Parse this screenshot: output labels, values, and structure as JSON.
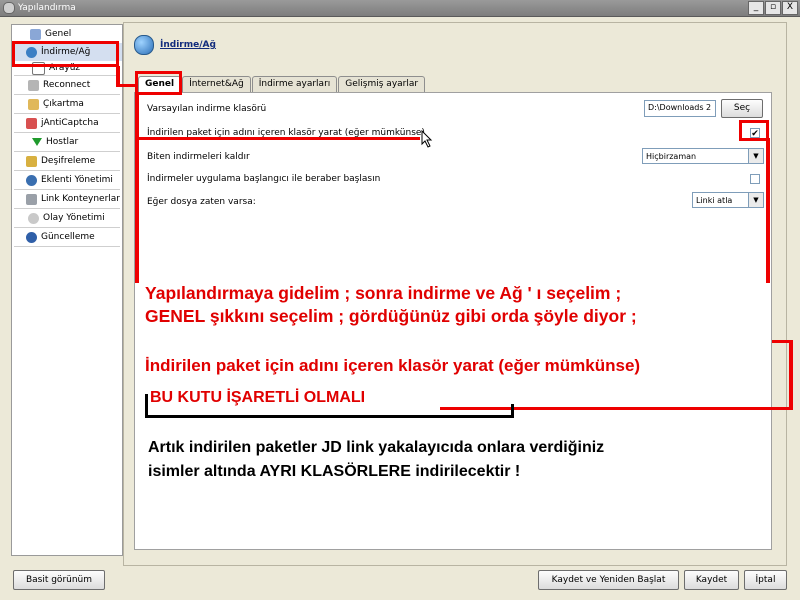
{
  "window": {
    "title": "Yapılandırma",
    "controls": [
      "_",
      "▫",
      "X"
    ]
  },
  "sidebar": {
    "items": [
      {
        "label": "Genel",
        "icon": "house-icon"
      },
      {
        "label": "İndirme/Ağ",
        "icon": "globe-icon"
      },
      {
        "label": "Arayüz",
        "icon": "window-icon"
      },
      {
        "label": "Reconnect",
        "icon": "reconnect-icon"
      },
      {
        "label": "Çıkartma",
        "icon": "extract-icon"
      },
      {
        "label": "jAntiCaptcha",
        "icon": "captcha-icon"
      },
      {
        "label": "Hostlar",
        "icon": "arrow-down-icon"
      },
      {
        "label": "Deşifreleme",
        "icon": "lock-icon"
      },
      {
        "label": "Eklenti Yönetimi",
        "icon": "plugin-icon"
      },
      {
        "label": "Link Konteynerlar",
        "icon": "container-icon"
      },
      {
        "label": "Olay Yönetimi",
        "icon": "event-icon"
      },
      {
        "label": "Güncelleme",
        "icon": "update-icon"
      }
    ]
  },
  "main": {
    "title": "İndirme/Ağ",
    "tabs": [
      "Genel",
      "İnternet&Ağ",
      "İndirme ayarları",
      "Gelişmiş ayarlar"
    ],
    "settings": {
      "download_folder_label": "Varsayılan indirme klasörü",
      "download_folder_value": "D:\\Downloads 2",
      "browse_button": "Seç",
      "create_subfolder_label": "İndirilen paket için adını içeren klasör yarat (eğer mümkünse)",
      "create_subfolder_checked": "✔",
      "remove_finished_label": "Biten indirmeleri kaldır",
      "remove_finished_value": "Hiçbirzaman",
      "start_with_app_label": "İndirmeler uygulama başlangıcı ile beraber başlasın",
      "file_exists_label": "Eğer dosya zaten varsa:",
      "file_exists_value": "Linki atla"
    }
  },
  "annotations": {
    "line1": "Yapılandırmaya gidelim ; sonra indirme ve Ağ ' ı seçelim ;",
    "line2": "GENEL şıkkını seçelim ; gördüğünüz gibi orda şöyle diyor ;",
    "line3": "İndirilen paket için adını içeren klasör yarat  (eğer mümkünse)",
    "line4": "BU KUTU İŞARETLİ OLMALI",
    "line5": "Artık indirilen paketler JD link yakalayıcıda onlara verdiğiniz",
    "line6": "isimler altında AYRI KLASÖRLERE indirilecektir !"
  },
  "footer": {
    "simple_view": "Basit görünüm",
    "save_restart": "Kaydet ve Yeniden Başlat",
    "save": "Kaydet",
    "cancel": "İptal"
  },
  "colors": {
    "annotation_red": "#e00000",
    "annotation_text": "#000000"
  }
}
